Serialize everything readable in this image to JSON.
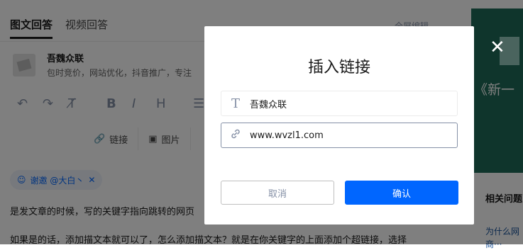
{
  "editor": {
    "tabs": [
      {
        "label": "图文回答"
      },
      {
        "label": "视频回答"
      }
    ],
    "header_right": "全屏编辑",
    "author": {
      "name": "吾魏众联",
      "desc": "包时竞价，网站优化，抖音推广，专注"
    },
    "toolbar_icons": [
      "undo-icon",
      "redo-icon",
      "clear-format-icon",
      "bold-icon",
      "italic-icon",
      "heading-icon",
      "list-icon"
    ],
    "toolbar2": [
      {
        "label": "链接",
        "icon": "link-icon"
      },
      {
        "label": "图片",
        "icon": "image-icon"
      }
    ],
    "invite": "谢邀 @大白丶",
    "paragraphs": [
      "是发文章的时候，写的关键字指向跳转的网页",
      "如果是的话，添加描文本就可以了，怎么添加描文本？就是在你关键字的上面添加个超链接，选择"
    ]
  },
  "sidebar": {
    "banner_text": "《新一",
    "title": "相关问题",
    "links": [
      "为什么网",
      "商···"
    ]
  },
  "modal": {
    "title": "插入链接",
    "text_field": {
      "value": "吾魏众联",
      "icon": "text-icon"
    },
    "url_field": {
      "value": "www.wvzl1.com",
      "icon": "link-icon"
    },
    "cancel_label": "取消",
    "ok_label": "确认"
  },
  "colors": {
    "accent": "#0066ff",
    "overlay": "rgba(0,0,0,0.5)"
  }
}
